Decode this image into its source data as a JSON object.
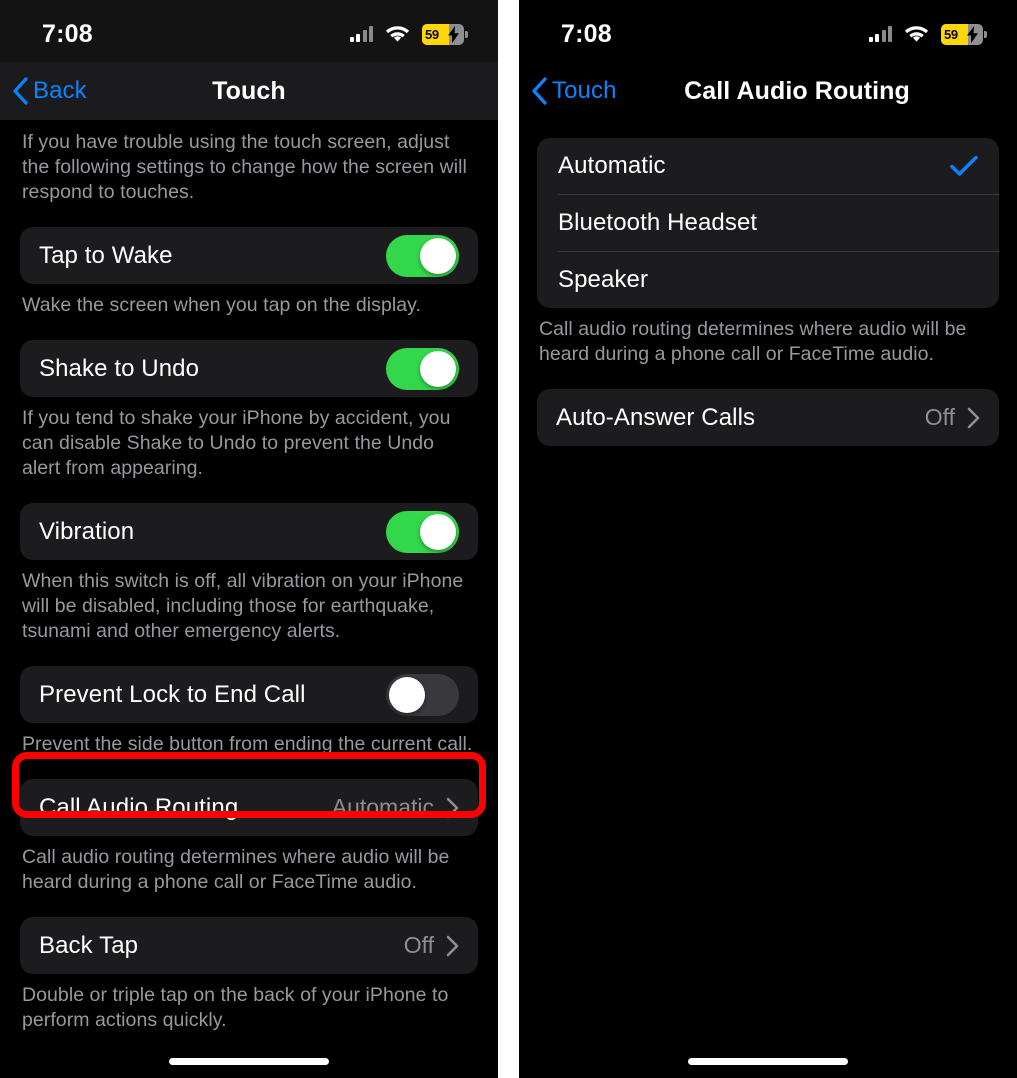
{
  "status_bar": {
    "time": "7:08",
    "battery_percent": "59",
    "battery_charging": true,
    "battery_color": "#ffd60a",
    "cellular_icon": "cellular-bars-icon",
    "wifi_icon": "wifi-icon"
  },
  "colors": {
    "accent_blue": "#0a84ff",
    "toggle_on_green": "#32d74b",
    "annotation_red": "#ff0000",
    "card_background": "#1c1c1e",
    "secondary_text": "#98989f"
  },
  "left_screen": {
    "nav": {
      "back_label": "Back",
      "title": "Touch"
    },
    "intro_footnote": "If you have trouble using the touch screen, adjust the following settings to change how the screen will respond to touches.",
    "rows": [
      {
        "label": "Tap to Wake",
        "control": "toggle",
        "state": "on",
        "footnote": "Wake the screen when you tap on the display."
      },
      {
        "label": "Shake to Undo",
        "control": "toggle",
        "state": "on",
        "footnote": "If you tend to shake your iPhone by accident, you can disable Shake to Undo to prevent the Undo alert from appearing."
      },
      {
        "label": "Vibration",
        "control": "toggle",
        "state": "on",
        "footnote": "When this switch is off, all vibration on your iPhone will be disabled, including those for earthquake, tsunami and other emergency alerts."
      },
      {
        "label": "Prevent Lock to End Call",
        "control": "toggle",
        "state": "off",
        "footnote": "Prevent the side button from ending the current call."
      },
      {
        "label": "Call Audio Routing",
        "control": "disclosure",
        "value": "Automatic",
        "footnote": "Call audio routing determines where audio will be heard during a phone call or FaceTime audio.",
        "highlighted": true
      },
      {
        "label": "Back Tap",
        "control": "disclosure",
        "value": "Off",
        "footnote": "Double or triple tap on the back of your iPhone to perform actions quickly."
      }
    ]
  },
  "right_screen": {
    "nav": {
      "back_label": "Touch",
      "title": "Call Audio Routing"
    },
    "options": [
      {
        "label": "Automatic",
        "selected": true,
        "highlighted": true
      },
      {
        "label": "Bluetooth Headset",
        "selected": false
      },
      {
        "label": "Speaker",
        "selected": false
      }
    ],
    "options_footnote": "Call audio routing determines where audio will be heard during a phone call or FaceTime audio.",
    "auto_answer": {
      "label": "Auto-Answer Calls",
      "value": "Off"
    }
  }
}
